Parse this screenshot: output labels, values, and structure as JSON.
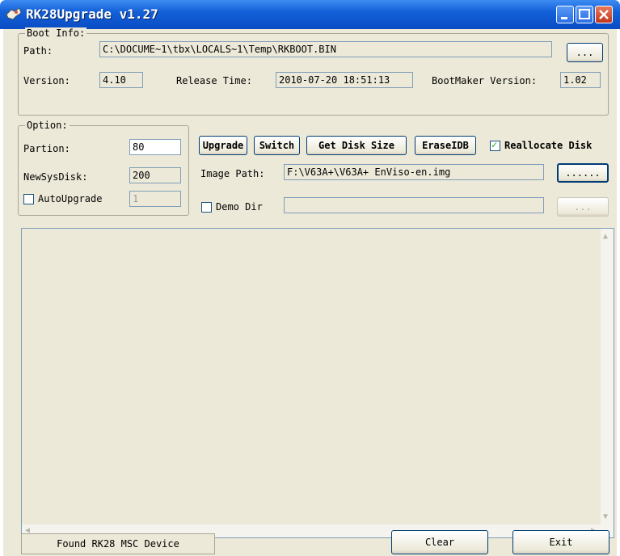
{
  "window": {
    "title": "RK28Upgrade v1.27"
  },
  "boot_info": {
    "group_label": "Boot Info:",
    "path_label": "Path:",
    "path_value": "C:\\DOCUME~1\\tbx\\LOCALS~1\\Temp\\RKBOOT.BIN",
    "browse_label": "...",
    "version_label": "Version:",
    "version_value": "4.10",
    "release_label": "Release Time:",
    "release_value": "2010-07-20 18:51:13",
    "bootmaker_label": "BootMaker Version:",
    "bootmaker_value": "1.02"
  },
  "option": {
    "group_label": "Option:",
    "partion_label": "Partion:",
    "partion_value": "80",
    "newsysdisk_label": "NewSysDisk:",
    "newsysdisk_value": "200",
    "autoupgrade_label": "AutoUpgrade",
    "autoupgrade_value": "1"
  },
  "actions": {
    "upgrade_label": "Upgrade",
    "switch_label": "Switch",
    "getdisksize_label": "Get Disk Size",
    "eraseidb_label": "EraseIDB",
    "reallocate_label": "Reallocate Disk",
    "reallocate_checked": true,
    "image_path_label": "Image Path:",
    "image_path_value": "F:\\V63A+\\V63A+ EnViso-en.img",
    "image_browse_label": "......",
    "demo_dir_label": "Demo Dir",
    "demo_dir_value": "",
    "demo_browse_label": "..."
  },
  "status": {
    "message": "Found RK28 MSC Device",
    "clear_label": "Clear",
    "exit_label": "Exit"
  },
  "colors": {
    "title_bar": "#0a4cc4",
    "dialog_bg": "#ece9d8",
    "field_border": "#7f9db9"
  }
}
